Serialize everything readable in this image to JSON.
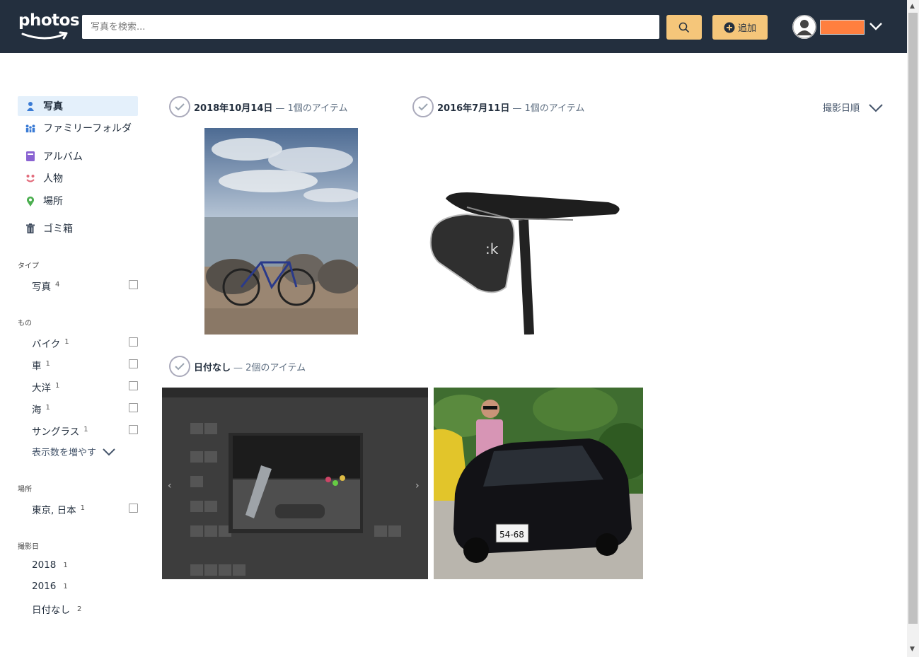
{
  "header": {
    "logo_text": "photos",
    "search_placeholder": "写真を検索...",
    "add_label": "追加"
  },
  "sidebar": {
    "nav": [
      {
        "label": "写真",
        "icon": "person-icon"
      },
      {
        "label": "ファミリーフォルダ",
        "icon": "family-icon"
      },
      {
        "label": "アルバム",
        "icon": "album-icon"
      },
      {
        "label": "人物",
        "icon": "face-icon"
      },
      {
        "label": "場所",
        "icon": "pin-icon"
      },
      {
        "label": "ゴミ箱",
        "icon": "trash-icon"
      }
    ],
    "type_title": "タイプ",
    "type_filters": [
      {
        "label": "写真",
        "count": "4"
      }
    ],
    "things_title": "もの",
    "things_filters": [
      {
        "label": "バイク",
        "count": "1"
      },
      {
        "label": "車",
        "count": "1"
      },
      {
        "label": "大洋",
        "count": "1"
      },
      {
        "label": "海",
        "count": "1"
      },
      {
        "label": "サングラス",
        "count": "1"
      }
    ],
    "more_label": "表示数を増やす",
    "places_title": "場所",
    "places_filters": [
      {
        "label": "東京, 日本",
        "count": "1"
      }
    ],
    "date_title": "撮影日",
    "date_filters": [
      {
        "label": "2018",
        "count": "1"
      },
      {
        "label": "2016",
        "count": "1"
      },
      {
        "label": "日付なし",
        "count": "2"
      }
    ]
  },
  "main": {
    "sort_label": "撮影日順",
    "groups": [
      {
        "date": "2018年10月14日",
        "count": "— 1個のアイテム"
      },
      {
        "date": "2016年7月11日",
        "count": "— 1個のアイテム"
      },
      {
        "date": "日付なし",
        "count": "— 2個のアイテム"
      }
    ]
  },
  "colors": {
    "header_bg": "#232f3e",
    "accent": "#f5c67a",
    "active_nav_bg": "#e4f0fb"
  }
}
